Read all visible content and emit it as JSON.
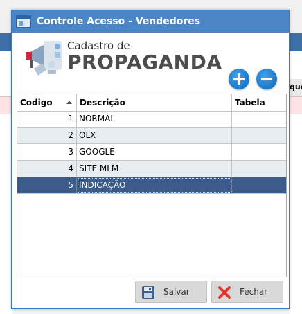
{
  "window": {
    "title": "Controle Acesso - Vendedores"
  },
  "background": {
    "right_header_fragment": "que"
  },
  "header": {
    "subtitle": "Cadastro de",
    "title": "PROPAGANDA"
  },
  "actions": {
    "add_icon": "plus-circle-icon",
    "remove_icon": "minus-circle-icon"
  },
  "grid": {
    "columns": [
      "Codigo",
      "Descrição",
      "Tabela"
    ],
    "sorted_column": "Codigo",
    "sort_direction": "ascending",
    "rows": [
      {
        "codigo": "1",
        "descricao": "NORMAL",
        "tabela": ""
      },
      {
        "codigo": "2",
        "descricao": "OLX",
        "tabela": ""
      },
      {
        "codigo": "3",
        "descricao": "GOOGLE",
        "tabela": ""
      },
      {
        "codigo": "4",
        "descricao": "SITE MLM",
        "tabela": ""
      },
      {
        "codigo": "5",
        "descricao": "INDICAÇÃO",
        "tabela": ""
      }
    ],
    "selected_row": 5
  },
  "footer": {
    "save_label": "Salvar",
    "close_label": "Fechar"
  },
  "colors": {
    "titlebar": "#4a86c5",
    "selected_row": "#3b5b8a",
    "alt_row": "#e8edf2",
    "round_button": "#1a7fd4"
  }
}
